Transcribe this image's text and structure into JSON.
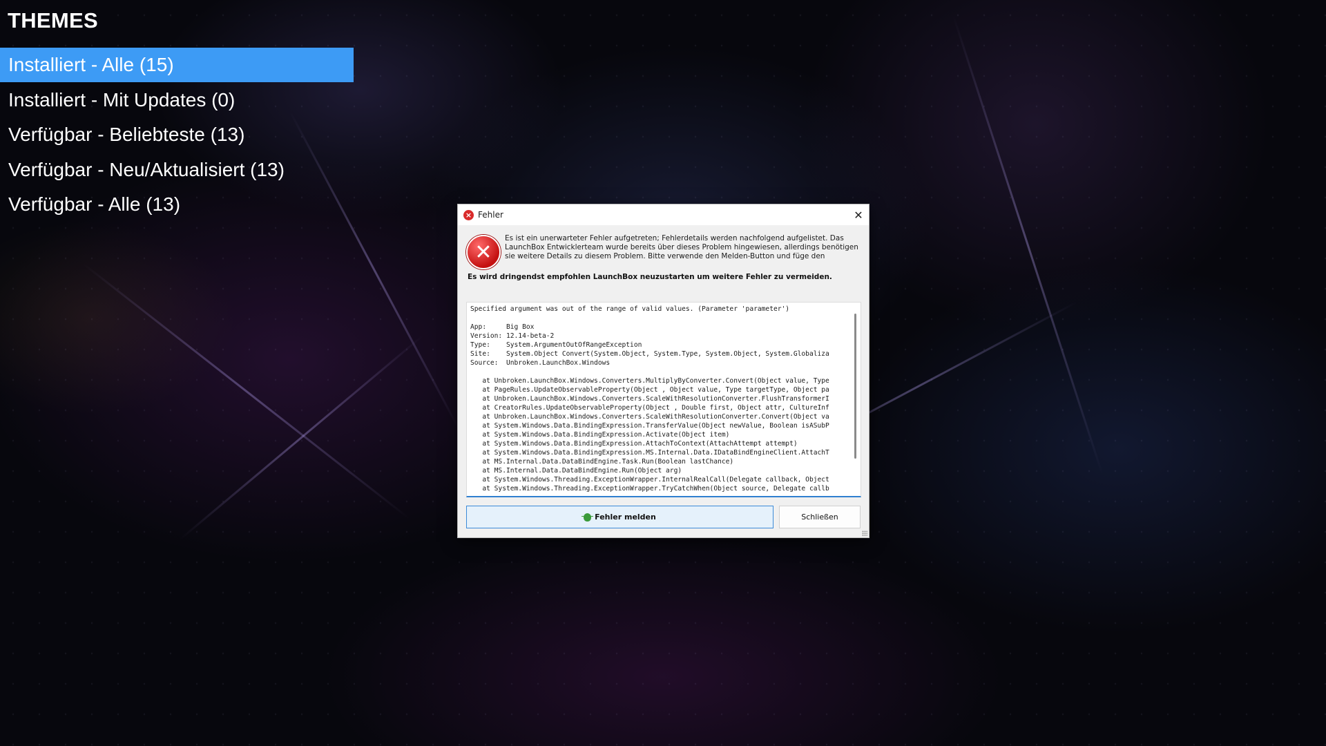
{
  "menu": {
    "title": "THEMES",
    "items": [
      {
        "label": "Installiert - Alle (15)",
        "selected": true
      },
      {
        "label": "Installiert - Mit Updates (0)",
        "selected": false
      },
      {
        "label": "Verfügbar - Beliebteste (13)",
        "selected": false
      },
      {
        "label": "Verfügbar - Neu/Aktualisiert (13)",
        "selected": false
      },
      {
        "label": "Verfügbar - Alle (13)",
        "selected": false
      }
    ],
    "selected_color": "#3d9bf5"
  },
  "dialog": {
    "title": "Fehler",
    "close_glyph": "✕",
    "intro_text": "Es ist ein unerwarteter Fehler aufgetreten; Fehlerdetails werden nachfolgend aufgelistet. Das LaunchBox Entwicklerteam wurde bereits über dieses Problem hingewiesen, allerdings benötigen sie weitere Details zu diesem Problem. Bitte verwende den Melden-Button und füge den nachfolgenden Text hinzu.",
    "warning_text": "Es wird dringendst empfohlen LaunchBox neuzustarten um weitere Fehler zu vermeiden.",
    "details_text": "Specified argument was out of the range of valid values. (Parameter 'parameter')\n\nApp:     Big Box\nVersion: 12.14-beta-2\nType:    System.ArgumentOutOfRangeException\nSite:    System.Object Convert(System.Object, System.Type, System.Object, System.Globaliza\nSource:  Unbroken.LaunchBox.Windows\n\n   at Unbroken.LaunchBox.Windows.Converters.MultiplyByConverter.Convert(Object value, Type\n   at PageRules.UpdateObservableProperty(Object , Object value, Type targetType, Object pa\n   at Unbroken.LaunchBox.Windows.Converters.ScaleWithResolutionConverter.FlushTransformerI\n   at CreatorRules.UpdateObservableProperty(Object , Double first, Object attr, CultureInf\n   at Unbroken.LaunchBox.Windows.Converters.ScaleWithResolutionConverter.Convert(Object va\n   at System.Windows.Data.BindingExpression.TransferValue(Object newValue, Boolean isASubP\n   at System.Windows.Data.BindingExpression.Activate(Object item)\n   at System.Windows.Data.BindingExpression.AttachToContext(AttachAttempt attempt)\n   at System.Windows.Data.BindingExpression.MS.Internal.Data.IDataBindEngineClient.AttachT\n   at MS.Internal.Data.DataBindEngine.Task.Run(Boolean lastChance)\n   at MS.Internal.Data.DataBindEngine.Run(Object arg)\n   at System.Windows.Threading.ExceptionWrapper.InternalRealCall(Delegate callback, Object\n   at System.Windows.Threading.ExceptionWrapper.TryCatchWhen(Object source, Delegate callb",
    "report_button_label": "Fehler melden",
    "close_button_label": "Schließen",
    "icons": {
      "title": "error-icon",
      "main": "error-icon",
      "report": "bug-icon"
    },
    "accent_color": "#3b8ad8"
  }
}
